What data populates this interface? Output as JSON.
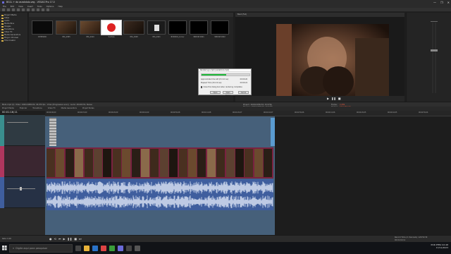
{
  "app": {
    "title": "BG1L + do asrakdolo.veg - VEGAS Pro 17.0"
  },
  "window_controls": [
    "—",
    "❐",
    "✕"
  ],
  "menu": [
    "File",
    "Edit",
    "View",
    "Insert",
    "Tools",
    "Options",
    "Help"
  ],
  "explorer": {
    "items": [
      "Project Media",
      "Video",
      "Audio",
      "Media Bins",
      "Images",
      "Transitions",
      "Video FX",
      "Media Generators",
      "Plug-in Chooser",
      "Title Creator"
    ]
  },
  "media_bin": {
    "clips": [
      "D3HBTA8C",
      "IMG_4895",
      "IMG_4910",
      "YouTube",
      "IMG_4908",
      "IMG_4921",
      "BVS0001_0.mov",
      "SB0348 0001",
      "SB0348 0002",
      "VEGAS Titles & Text"
    ]
  },
  "preview": {
    "header": "Best (Full)",
    "project_info": "Project: 1920x1080x32, 29.970p",
    "preview_info": "Preview: 1920x1080x32, 29.970p",
    "frame_label": "Frame:",
    "frame_value": "2,289",
    "display_label": "Display:",
    "display_value": "640x360x32"
  },
  "mid_strip": {
    "text": "BG1L.mp4 (1): Video: 1920x1080x32, 29.970 fps · Video [Progressive scan] · Audio: 48,000 Hz, Stereo"
  },
  "tabs": [
    "Project Media",
    "Explorer",
    "Transitions",
    "Video FX",
    "Media Generators",
    "Project Notes"
  ],
  "timecode": "00:01:16;11",
  "ruler_labels": [
    "00:00:00;00",
    "00:00:15;00",
    "00:00:29;29",
    "00:00:44;29",
    "00:00:59;28",
    "00:01:14;28",
    "00:01:29;27",
    "00:01:44;27",
    "00:01:59;26",
    "00:02:14;26",
    "00:02:29;25",
    "00:02:44;25",
    "00:02:59;24"
  ],
  "dialog": {
    "title": "Rendering a mp4 (asrakdolo.mp4)",
    "progress_percent": 52,
    "rows": [
      {
        "label": "Approximate time left (hh:mm:ss):",
        "value": "00:00:26"
      },
      {
        "label": "Elapsed Time (hh:mm:ss):",
        "value": "00:00:24"
      }
    ],
    "checkbox": "Close this dialog box when rendering completes",
    "buttons": [
      "Open",
      "Open Folder",
      "Cancel"
    ]
  },
  "transport": {
    "rate": "Rate: 0,00",
    "status": "Record Time (2 channels): 129:50:39",
    "time": "00:01:16;11"
  },
  "taskbar": {
    "search_placeholder": "Digite aqui para pesquisar",
    "time": "02:48",
    "date": "17/11/2023",
    "tray_text": "POR PTB2"
  },
  "colors": {
    "progress": "#1fb83a",
    "video_track": "#7a2240",
    "audio_track": "#3f5e9e",
    "taskbar_bg": "#111317"
  }
}
